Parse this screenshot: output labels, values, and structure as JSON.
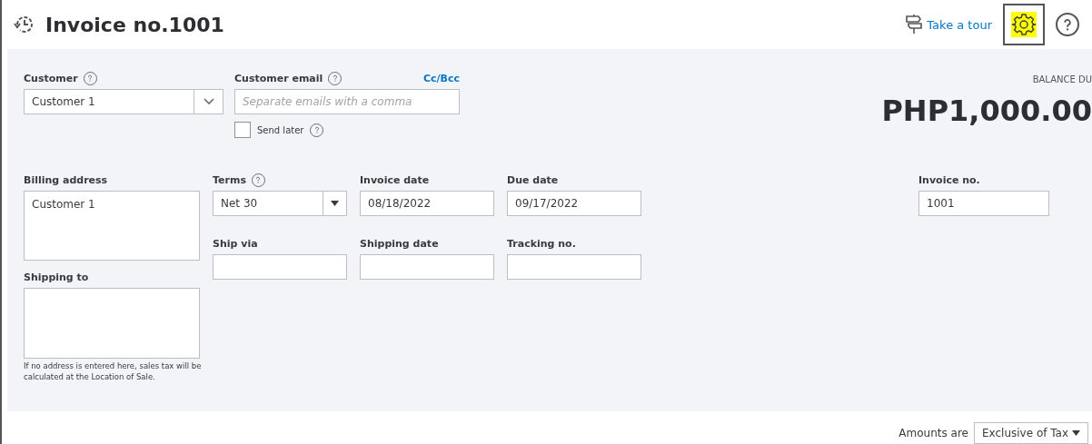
{
  "header": {
    "title": "Invoice no.1001",
    "tour_link": "Take a tour",
    "settings_highlighted": true
  },
  "customer": {
    "label": "Customer",
    "value": "Customer 1"
  },
  "customer_email": {
    "label": "Customer email",
    "placeholder": "Separate emails with a comma",
    "cc_link": "Cc/Bcc"
  },
  "send_later": {
    "label": "Send later",
    "checked": false
  },
  "balance": {
    "label": "BALANCE DU",
    "amount": "PHP1,000.00"
  },
  "billing_address": {
    "label": "Billing address",
    "value": "Customer 1"
  },
  "shipping_to": {
    "label": "Shipping to",
    "note": "If no address is entered here, sales tax will be calculated at the Location of Sale."
  },
  "terms": {
    "label": "Terms",
    "value": "Net 30"
  },
  "fields": [
    {
      "label": "Invoice date",
      "value": "08/18/2022"
    },
    {
      "label": "Due date",
      "value": "09/17/2022"
    },
    {
      "label": "Ship via"
    },
    {
      "label": "Shipping date"
    },
    {
      "label": "Tracking no."
    }
  ],
  "invoice_no": {
    "label": "Invoice no.",
    "value": "1001"
  },
  "amounts": {
    "label": "Amounts are",
    "value": "Exclusive of Tax"
  }
}
